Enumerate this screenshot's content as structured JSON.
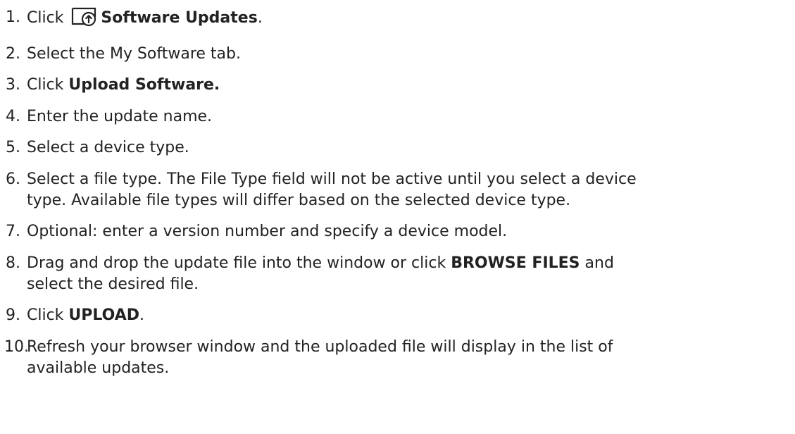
{
  "steps": [
    {
      "num": "1.",
      "pre": "Click",
      "bold": "Software Updates",
      "post": ".",
      "icon": "software-update-icon"
    },
    {
      "num": "2.",
      "text": "Select the My Software tab."
    },
    {
      "num": "3.",
      "pre": "Click ",
      "bold": "Upload Software.",
      "post": ""
    },
    {
      "num": "4.",
      "text": "Enter the update name."
    },
    {
      "num": "5.",
      "text": "Select a device type."
    },
    {
      "num": "6.",
      "line1": "Select a file type. The File Type field will not be active until you select a device",
      "line2": "type. Available file types will differ based on the selected device type."
    },
    {
      "num": "7.",
      "text": "Optional: enter a version number and specify a device model."
    },
    {
      "num": "8.",
      "pre": "Drag and drop the update file into the window or click ",
      "bold": "BROWSE FILES",
      "post": " and",
      "line2": "select the desired file."
    },
    {
      "num": "9.",
      "pre": "Click ",
      "bold": "UPLOAD",
      "post": "."
    },
    {
      "num": "10.",
      "line1": "Refresh your browser window and the uploaded file will display in the list of",
      "line2": "available updates."
    }
  ]
}
